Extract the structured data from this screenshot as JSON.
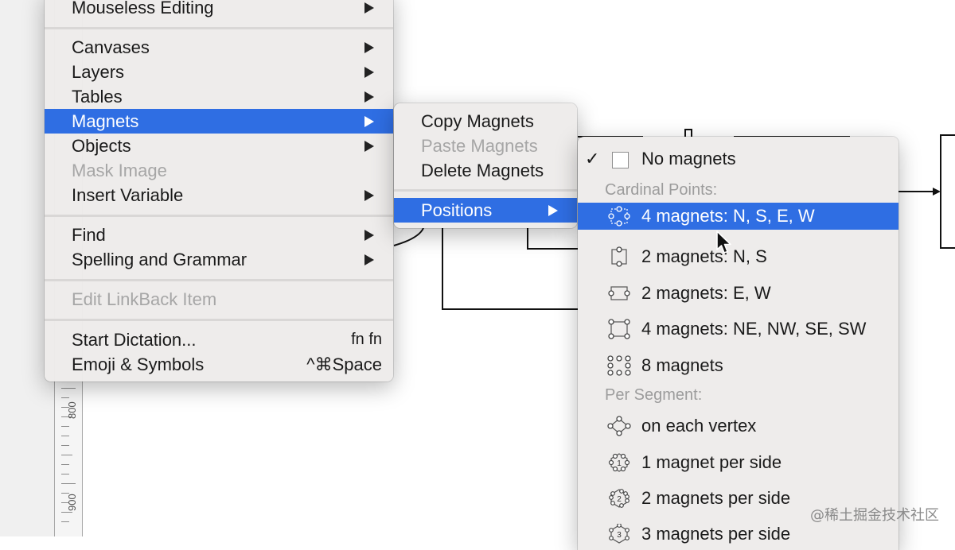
{
  "main_menu": {
    "items": [
      {
        "label": "Mouseless Editing",
        "submenu": true
      },
      {
        "label": "Canvases",
        "submenu": true
      },
      {
        "label": "Layers",
        "submenu": true
      },
      {
        "label": "Tables",
        "submenu": true
      },
      {
        "label": "Magnets",
        "submenu": true,
        "highlighted": true
      },
      {
        "label": "Objects",
        "submenu": true
      },
      {
        "label": "Mask Image",
        "disabled": true
      },
      {
        "label": "Insert Variable",
        "submenu": true
      },
      {
        "label": "Find",
        "submenu": true
      },
      {
        "label": "Spelling and Grammar",
        "submenu": true
      },
      {
        "label": "Edit LinkBack Item",
        "disabled": true
      },
      {
        "label": "Start Dictation...",
        "shortcut": "fn fn"
      },
      {
        "label": "Emoji & Symbols",
        "shortcut": "^⌘Space"
      }
    ]
  },
  "magnets_menu": {
    "items": [
      {
        "label": "Copy Magnets"
      },
      {
        "label": "Paste Magnets",
        "disabled": true
      },
      {
        "label": "Delete Magnets"
      },
      {
        "label": "Positions",
        "submenu": true,
        "highlighted": true
      }
    ]
  },
  "positions_menu": {
    "no_magnets": {
      "label": "No magnets",
      "checked": true
    },
    "cardinal_header": "Cardinal Points:",
    "cardinal_items": [
      {
        "label": "4 magnets: N, S, E, W",
        "icon": "magnets-nsew-icon",
        "highlighted": true
      },
      {
        "label": "2 magnets: N, S",
        "icon": "magnets-ns-icon"
      },
      {
        "label": "2 magnets: E, W",
        "icon": "magnets-ew-icon"
      },
      {
        "label": "4 magnets: NE, NW, SE, SW",
        "icon": "magnets-corners-icon"
      },
      {
        "label": "8 magnets",
        "icon": "magnets-eight-icon"
      }
    ],
    "segment_header": "Per Segment:",
    "segment_items": [
      {
        "label": "on each vertex",
        "icon": "magnets-vertex-icon"
      },
      {
        "label": "1 magnet per side",
        "icon": "magnets-one-per-side-icon"
      },
      {
        "label": "2 magnets per side",
        "icon": "magnets-two-per-side-icon"
      },
      {
        "label": "3 magnets per side",
        "icon": "magnets-three-per-side-icon"
      }
    ]
  },
  "ruler": {
    "labels": [
      "800",
      "900"
    ]
  },
  "watermark": "@稀土掘金技术社区",
  "colors": {
    "highlight": "#2f6ee3",
    "menu_bg": "#eeeceb",
    "disabled_text": "#a6a6a6"
  }
}
